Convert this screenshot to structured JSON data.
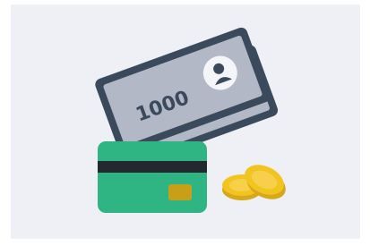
{
  "illustration": {
    "subject": "payment-methods",
    "bill_amount": "1000",
    "colors": {
      "background_panel": "#eff0f6",
      "bill_outline": "#3a4a5c",
      "bill_fill": "#b3b8c7",
      "portrait_circle": "#f4f5f9",
      "card_green": "#2fb583",
      "card_stripe": "#24292f",
      "card_chip": "#c8a018",
      "coin_gold": "#f2c420",
      "coin_edge": "#d6a81a"
    }
  }
}
